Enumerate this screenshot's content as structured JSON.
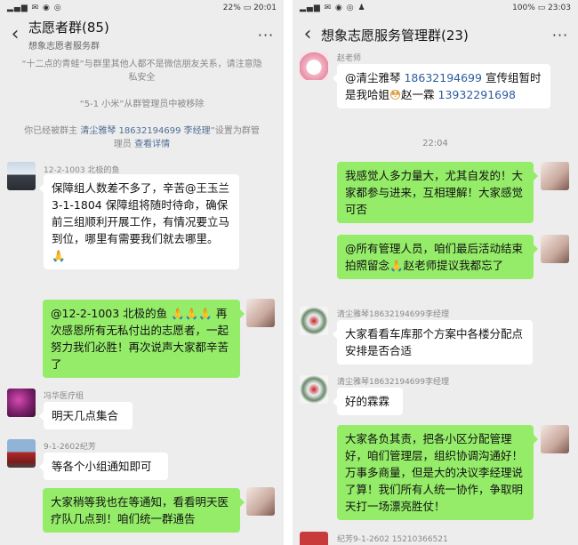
{
  "left": {
    "status": {
      "battery": "22%",
      "time": "20:01"
    },
    "header": {
      "title": "志愿者群(85)",
      "subtitle": "想象志愿者服务群"
    },
    "system": [
      {
        "text": "“十二点的青蛙”与群里其他人都不是微信朋友关系，请注意隐私安全"
      },
      {
        "text": "“5-1 小米”从群管理员中被移除"
      },
      {
        "pre": "你已经被群主 ",
        "link": "清尘雅琴 18632194699 李经理",
        "mid": "”设置为群管理员 ",
        "link2": "查看详情"
      }
    ],
    "messages": [
      {
        "sender": "12-2-1003 北极的鱼",
        "text": "保障组人数差不多了，辛苦@王玉兰 3-1-1804  保障组将随时待命，确保前三组顺利开展工作，有情况要立马到位，哪里有需要我们就去哪里。",
        "emoji": "🙏"
      },
      {
        "sender": "",
        "text_prefix": "@12-2-1003 北极的鱼 ",
        "emoji": "🙏🙏🙏",
        "text": "再次感恩所有无私付出的志愿者，一起努力我们必胜！再次说声大家都辛苦了"
      },
      {
        "sender": "冯华医疗组",
        "text": "明天几点集合"
      },
      {
        "sender": "9-1-2602纪芳",
        "text": "等各个小组通知即可"
      },
      {
        "sender": "",
        "text": "大家稍等我也在等通知，看看明天医疗队几点到！咱们统一群通告"
      }
    ]
  },
  "right": {
    "status": {
      "battery": "100%",
      "time": "23:03"
    },
    "header": {
      "title": "想象志愿服务管理群(23)"
    },
    "time_divider": "22:04",
    "messages": [
      {
        "sender": "赵老师",
        "pre": "@清尘雅琴 ",
        "phone1": "18632194699",
        "mid": " 宣传组暂时是我哈姐",
        "emoji": "😳",
        "post": "赵一霖 ",
        "phone2": "13932291698"
      },
      {
        "sender": "",
        "text": "我感觉人多力量大，尤其自发的！大家都参与进来，互相理解！大家感觉可否"
      },
      {
        "sender": "",
        "pre": "@所有管理人员，咱们最后活动结束拍照留念",
        "emoji": "🙏",
        "post": "赵老师提议我都忘了"
      },
      {
        "sender": "清尘雅琴18632194699李经理",
        "text": "大家看看车库那个方案中各楼分配点安排是否合适"
      },
      {
        "sender": "清尘雅琴18632194699李经理",
        "text": "好的霖霖"
      },
      {
        "sender": "",
        "text": "大家各负其责，把各小区分配管理好，咱们管理层，组织协调沟通好！万事多商量，但是大的决议李经理说了算！我们所有人统一协作，争取明天打一场漂亮胜仗！"
      },
      {
        "sender": "纪芳9-1-2602",
        "phone": "15210366521"
      }
    ]
  }
}
